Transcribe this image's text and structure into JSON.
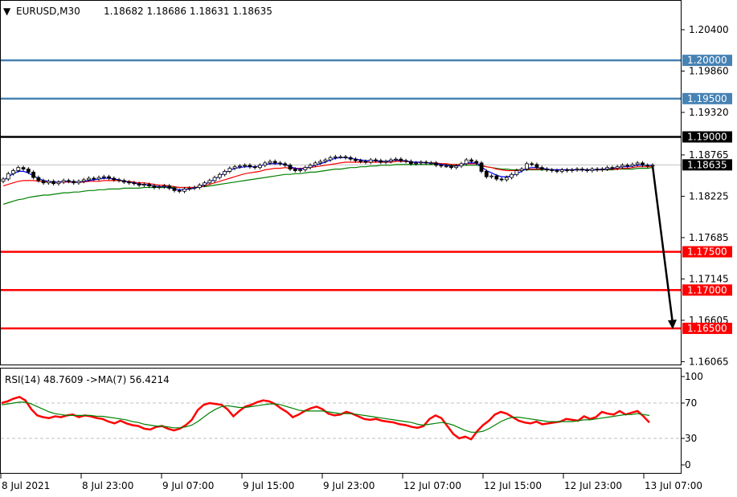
{
  "header": {
    "symbol": "EURUSD,M30",
    "ohlc": "1.18682 1.18686 1.18631 1.18635",
    "menu_glyph": "▼"
  },
  "colors": {
    "blue_level": "#4682b4",
    "black_level": "#000000",
    "red_level": "#ff0000",
    "ma_fast": "#0000ff",
    "ma_mid": "#ff0000",
    "ma_slow": "#008000",
    "rsi": "#ff0000",
    "rsi_ma": "#008000",
    "candle": "#000000"
  },
  "chart_data": [
    {
      "type": "candlestick",
      "title": "EURUSD,M30",
      "ylim": [
        1.1595,
        1.2083
      ],
      "price_ticks": [
        "1.20400",
        "1.19860",
        "1.19320",
        "1.18765",
        "1.18225",
        "1.17685",
        "1.17145",
        "1.16605",
        "1.16065"
      ],
      "levels": [
        {
          "value": 1.2,
          "label": "1.20000",
          "color": "#4682b4"
        },
        {
          "value": 1.195,
          "label": "1.19500",
          "color": "#4682b4"
        },
        {
          "value": 1.19,
          "label": "1.19000",
          "color": "#000000"
        },
        {
          "value": 1.175,
          "label": "1.17500",
          "color": "#ff0000"
        },
        {
          "value": 1.17,
          "label": "1.17000",
          "color": "#ff0000"
        },
        {
          "value": 1.165,
          "label": "1.16500",
          "color": "#ff0000"
        }
      ],
      "current_price": {
        "value": 1.18635,
        "label": "1.18635"
      },
      "forecast_arrow": {
        "from": 1.1862,
        "to": 1.165
      },
      "time_labels": [
        "8 Jul 2021",
        "8 Jul 23:00",
        "9 Jul 07:00",
        "9 Jul 15:00",
        "9 Jul 23:00",
        "12 Jul 07:00",
        "12 Jul 15:00",
        "12 Jul 23:00",
        "13 Jul 07:00"
      ],
      "close_series": [
        1.1845,
        1.1852,
        1.1856,
        1.186,
        1.1858,
        1.1854,
        1.1847,
        1.1843,
        1.184,
        1.1842,
        1.1839,
        1.1841,
        1.1843,
        1.1842,
        1.184,
        1.1842,
        1.1844,
        1.1846,
        1.1845,
        1.1847,
        1.1848,
        1.1846,
        1.1844,
        1.1843,
        1.1841,
        1.184,
        1.1839,
        1.1837,
        1.1838,
        1.1836,
        1.1834,
        1.1835,
        1.1836,
        1.1833,
        1.183,
        1.1829,
        1.1832,
        1.1833,
        1.1834,
        1.1837,
        1.184,
        1.1843,
        1.1847,
        1.1851,
        1.1855,
        1.1859,
        1.1861,
        1.1862,
        1.1863,
        1.1861,
        1.186,
        1.1863,
        1.1866,
        1.1868,
        1.1866,
        1.1865,
        1.1863,
        1.1858,
        1.1856,
        1.1857,
        1.186,
        1.1863,
        1.1866,
        1.1868,
        1.187,
        1.1873,
        1.1874,
        1.1874,
        1.1873,
        1.1871,
        1.1869,
        1.1868,
        1.1867,
        1.187,
        1.1869,
        1.1867,
        1.1868,
        1.187,
        1.1871,
        1.1869,
        1.1868,
        1.1865,
        1.1866,
        1.1867,
        1.1866,
        1.1866,
        1.1863,
        1.1862,
        1.1862,
        1.186,
        1.1862,
        1.1865,
        1.187,
        1.1868,
        1.1866,
        1.1855,
        1.1848,
        1.1849,
        1.1845,
        1.1844,
        1.1847,
        1.1851,
        1.1856,
        1.1858,
        1.1865,
        1.1864,
        1.186,
        1.1858,
        1.1857,
        1.1856,
        1.1855,
        1.1857,
        1.1856,
        1.1857,
        1.1858,
        1.1857,
        1.1856,
        1.1858,
        1.1857,
        1.1858,
        1.186,
        1.1859,
        1.1861,
        1.1863,
        1.1862,
        1.1864,
        1.1866,
        1.1863,
        1.1862,
        1.1863
      ],
      "ma_fast": [
        1.1843,
        1.1848,
        1.1852,
        1.1855,
        1.1855,
        1.1853,
        1.1849,
        1.1846,
        1.1843,
        1.1842,
        1.1841,
        1.1841,
        1.1842,
        1.1842,
        1.1841,
        1.1841,
        1.1842,
        1.1843,
        1.1844,
        1.1845,
        1.1846,
        1.1846,
        1.1845,
        1.1844,
        1.1842,
        1.1841,
        1.184,
        1.1838,
        1.1838,
        1.1837,
        1.1836,
        1.1835,
        1.1835,
        1.1834,
        1.1832,
        1.1831,
        1.1831,
        1.1832,
        1.1833,
        1.1835,
        1.1838,
        1.1841,
        1.1845,
        1.1849,
        1.1853,
        1.1856,
        1.1859,
        1.186,
        1.1861,
        1.1861,
        1.1861,
        1.1862,
        1.1864,
        1.1865,
        1.1865,
        1.1865,
        1.1864,
        1.1861,
        1.1859,
        1.1858,
        1.1859,
        1.1861,
        1.1863,
        1.1865,
        1.1867,
        1.187,
        1.1872,
        1.1873,
        1.1873,
        1.1872,
        1.1871,
        1.187,
        1.1869,
        1.1869,
        1.1869,
        1.1868,
        1.1868,
        1.1869,
        1.187,
        1.1869,
        1.1869,
        1.1867,
        1.1867,
        1.1867,
        1.1866,
        1.1866,
        1.1865,
        1.1864,
        1.1863,
        1.1862,
        1.1862,
        1.1863,
        1.1866,
        1.1866,
        1.1866,
        1.1861,
        1.1856,
        1.1853,
        1.185,
        1.1848,
        1.1848,
        1.1849,
        1.1852,
        1.1855,
        1.1859,
        1.186,
        1.186,
        1.1859,
        1.1858,
        1.1857,
        1.1857,
        1.1857,
        1.1857,
        1.1857,
        1.1857,
        1.1857,
        1.1857,
        1.1857,
        1.1857,
        1.1858,
        1.1858,
        1.1859,
        1.186,
        1.1861,
        1.1861,
        1.1862,
        1.1863,
        1.1863,
        1.1863,
        1.1863
      ],
      "ma_mid": [
        1.1836,
        1.1838,
        1.184,
        1.1842,
        1.1843,
        1.1843,
        1.1843,
        1.1842,
        1.1842,
        1.1841,
        1.1841,
        1.1841,
        1.1841,
        1.1841,
        1.1841,
        1.1841,
        1.1841,
        1.1842,
        1.1842,
        1.1842,
        1.1843,
        1.1843,
        1.1843,
        1.1843,
        1.1842,
        1.1842,
        1.1841,
        1.184,
        1.184,
        1.1839,
        1.1838,
        1.1837,
        1.1837,
        1.1836,
        1.1835,
        1.1834,
        1.1834,
        1.1834,
        1.1834,
        1.1835,
        1.1836,
        1.1838,
        1.184,
        1.1842,
        1.1844,
        1.1846,
        1.1848,
        1.185,
        1.1852,
        1.1853,
        1.1854,
        1.1855,
        1.1857,
        1.1858,
        1.1859,
        1.1859,
        1.186,
        1.1859,
        1.1859,
        1.1859,
        1.1859,
        1.186,
        1.1861,
        1.1862,
        1.1863,
        1.1864,
        1.1865,
        1.1866,
        1.1867,
        1.1867,
        1.1867,
        1.1867,
        1.1867,
        1.1867,
        1.1867,
        1.1867,
        1.1867,
        1.1867,
        1.1868,
        1.1868,
        1.1868,
        1.1867,
        1.1867,
        1.1867,
        1.1866,
        1.1866,
        1.1866,
        1.1865,
        1.1865,
        1.1864,
        1.1864,
        1.1864,
        1.1865,
        1.1865,
        1.1865,
        1.1863,
        1.1861,
        1.186,
        1.1858,
        1.1857,
        1.1856,
        1.1856,
        1.1856,
        1.1857,
        1.1858,
        1.1858,
        1.1858,
        1.1858,
        1.1858,
        1.1857,
        1.1857,
        1.1857,
        1.1857,
        1.1857,
        1.1857,
        1.1857,
        1.1857,
        1.1857,
        1.1857,
        1.1857,
        1.1858,
        1.1858,
        1.1858,
        1.1859,
        1.1859,
        1.186,
        1.1861,
        1.1861,
        1.1861,
        1.1861
      ],
      "ma_slow": [
        1.1812,
        1.1814,
        1.1816,
        1.1818,
        1.1819,
        1.1821,
        1.1822,
        1.1823,
        1.1824,
        1.1824,
        1.1825,
        1.1826,
        1.1827,
        1.1827,
        1.1828,
        1.1828,
        1.1829,
        1.183,
        1.183,
        1.1831,
        1.1831,
        1.1832,
        1.1832,
        1.1832,
        1.1833,
        1.1833,
        1.1833,
        1.1833,
        1.1834,
        1.1834,
        1.1834,
        1.1834,
        1.1834,
        1.1834,
        1.1834,
        1.1834,
        1.1834,
        1.1834,
        1.1834,
        1.1835,
        1.1835,
        1.1836,
        1.1837,
        1.1838,
        1.1839,
        1.184,
        1.1841,
        1.1842,
        1.1843,
        1.1844,
        1.1845,
        1.1846,
        1.1847,
        1.1848,
        1.1849,
        1.185,
        1.1851,
        1.1851,
        1.1852,
        1.1852,
        1.1853,
        1.1854,
        1.1854,
        1.1855,
        1.1856,
        1.1857,
        1.1858,
        1.1858,
        1.1859,
        1.186,
        1.186,
        1.1861,
        1.1861,
        1.1862,
        1.1862,
        1.1863,
        1.1863,
        1.1863,
        1.1864,
        1.1864,
        1.1864,
        1.1864,
        1.1864,
        1.1864,
        1.1864,
        1.1864,
        1.1864,
        1.1864,
        1.1864,
        1.1863,
        1.1863,
        1.1863,
        1.1863,
        1.1863,
        1.1863,
        1.1862,
        1.1861,
        1.186,
        1.1859,
        1.1858,
        1.1858,
        1.1857,
        1.1857,
        1.1857,
        1.1857,
        1.1857,
        1.1857,
        1.1857,
        1.1857,
        1.1857,
        1.1857,
        1.1857,
        1.1857,
        1.1857,
        1.1857,
        1.1857,
        1.1857,
        1.1857,
        1.1857,
        1.1857,
        1.1857,
        1.1857,
        1.1858,
        1.1858,
        1.1858,
        1.1858,
        1.1859,
        1.1859,
        1.1859,
        1.186
      ]
    },
    {
      "type": "line",
      "title": "RSI(14) 48.7609 ->MA(7) 56.4214",
      "ylim": [
        -5,
        107
      ],
      "y_ticks": [
        "100",
        "70",
        "30",
        "0"
      ],
      "guide_levels": [
        70,
        30
      ],
      "series": [
        {
          "name": "RSI(14)",
          "color": "#ff0000",
          "values": [
            70,
            72,
            75,
            77,
            73,
            63,
            56,
            54,
            53,
            55,
            54,
            56,
            57,
            54,
            56,
            55,
            53,
            52,
            49,
            47,
            50,
            47,
            45,
            44,
            41,
            40,
            43,
            44,
            41,
            39,
            41,
            45,
            51,
            62,
            68,
            70,
            69,
            68,
            63,
            55,
            61,
            66,
            68,
            71,
            73,
            72,
            69,
            64,
            60,
            54,
            57,
            61,
            64,
            66,
            63,
            58,
            56,
            57,
            60,
            58,
            55,
            52,
            51,
            52,
            50,
            49,
            48,
            46,
            45,
            43,
            42,
            44,
            52,
            56,
            53,
            44,
            35,
            30,
            32,
            29,
            38,
            45,
            50,
            57,
            60,
            58,
            54,
            50,
            48,
            47,
            49,
            46,
            47,
            48,
            49,
            52,
            51,
            50,
            55,
            52,
            54,
            60,
            58,
            57,
            61,
            57,
            59,
            61,
            55,
            48
          ]
        },
        {
          "name": "MA(7)",
          "color": "#008000",
          "values": [
            68,
            69,
            70,
            71,
            71,
            69,
            66,
            63,
            60,
            58,
            57,
            56,
            56,
            56,
            56,
            56,
            55,
            55,
            54,
            53,
            52,
            51,
            49,
            48,
            46,
            45,
            44,
            44,
            43,
            42,
            42,
            43,
            45,
            49,
            54,
            59,
            63,
            66,
            67,
            66,
            65,
            65,
            66,
            67,
            68,
            69,
            69,
            68,
            66,
            64,
            62,
            61,
            61,
            61,
            61,
            60,
            59,
            58,
            58,
            58,
            57,
            56,
            55,
            54,
            53,
            52,
            51,
            50,
            49,
            48,
            46,
            45,
            46,
            47,
            48,
            47,
            45,
            42,
            39,
            37,
            37,
            38,
            41,
            45,
            49,
            52,
            54,
            54,
            53,
            52,
            51,
            50,
            49,
            49,
            49,
            49,
            49,
            50,
            51,
            51,
            52,
            53,
            54,
            55,
            56,
            57,
            57,
            58,
            57,
            56
          ]
        }
      ]
    }
  ]
}
